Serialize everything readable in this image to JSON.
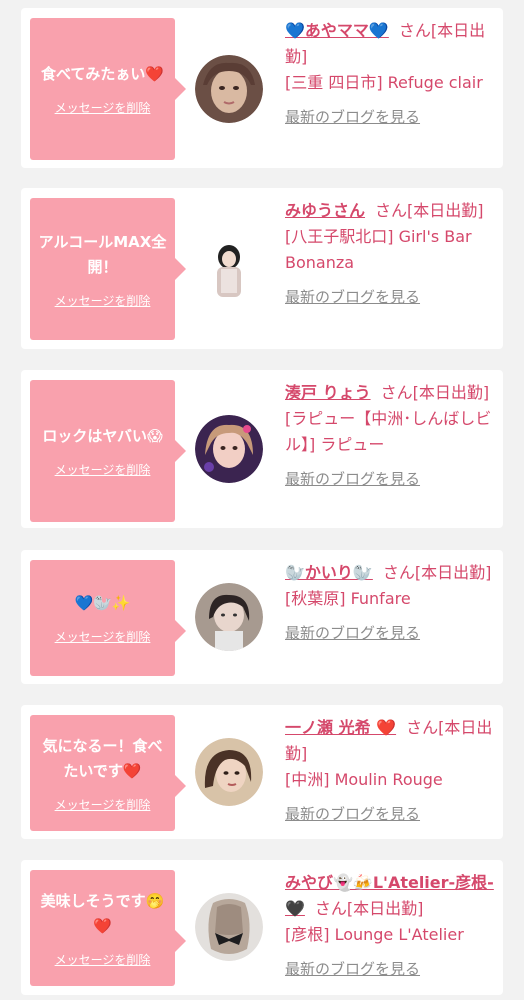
{
  "cards": [
    {
      "message": "食べてみたぁい❤️",
      "delete_label": "メッセージを削除",
      "name": "💙あやママ💙",
      "suffix": "さん[本日出勤]",
      "location": "[三重 四日市] Refuge clair",
      "blog_label": "最新のブログを見る",
      "avatar_icon": "avatar-photo"
    },
    {
      "message": "アルコールMAX全開！",
      "delete_label": "メッセージを削除",
      "name": "みゆうさん",
      "suffix": "さん[本日出勤]",
      "location": "[八王子駅北口] Girl's Bar Bonanza",
      "blog_label": "最新のブログを見る",
      "avatar_icon": "avatar-photo"
    },
    {
      "message": "ロックはヤバい😱",
      "delete_label": "メッセージを削除",
      "name": "湊戸 りょう",
      "suffix": "さん[本日出勤]",
      "location": "[ラピュー【中洲･しんばしビル】] ラピュー",
      "blog_label": "最新のブログを見る",
      "avatar_icon": "avatar-photo"
    },
    {
      "message": "💙🦭✨",
      "delete_label": "メッセージを削除",
      "name": "🦭かいり🦭",
      "suffix": "さん[本日出勤]",
      "location": "[秋葉原] Funfare",
      "blog_label": "最新のブログを見る",
      "avatar_icon": "avatar-photo"
    },
    {
      "message": "気になるー！食べたいです❤️",
      "delete_label": "メッセージを削除",
      "name": "一ノ瀬 光希 ❤️",
      "suffix": "さん[本日出勤]",
      "location": "[中洲] Moulin Rouge",
      "blog_label": "最新のブログを見る",
      "avatar_icon": "avatar-photo"
    },
    {
      "message": "美味しそうです🤭❤️",
      "delete_label": "メッセージを削除",
      "name": "みやび👻🍻L'Atelier-彦根-🖤",
      "suffix": "さん[本日出勤]",
      "location": "[彦根] Lounge L'Atelier",
      "blog_label": "最新のブログを見る",
      "avatar_icon": "avatar-photo"
    }
  ],
  "colors": {
    "bubble": "#f9a1ad",
    "accent": "#d5486b",
    "blog_link": "#8c8c8c",
    "background": "#f2f2f2"
  }
}
